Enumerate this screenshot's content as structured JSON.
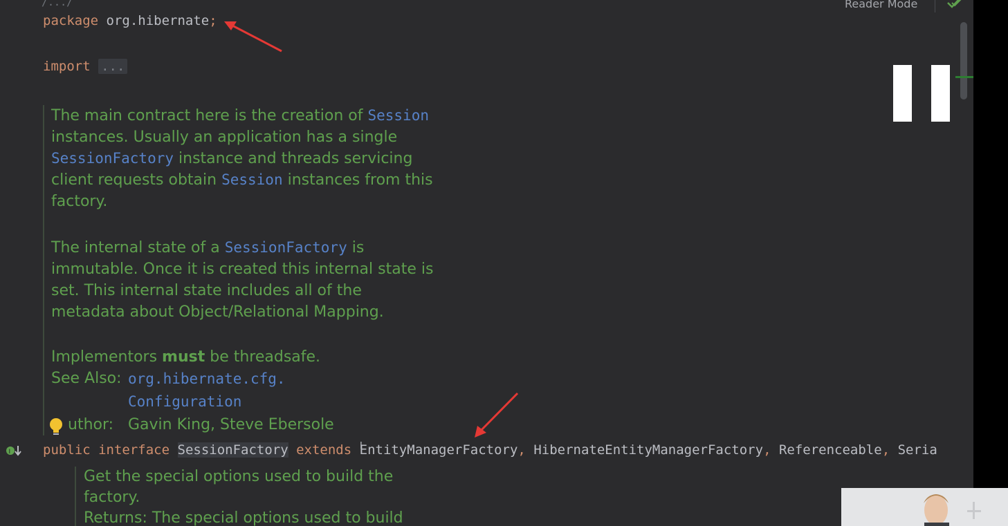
{
  "code": {
    "fold_marker": "/.../",
    "package_kw": "package",
    "package_name": "org.hibernate",
    "semicolon": ";",
    "import_kw": "import",
    "import_dots": "..."
  },
  "javadoc": {
    "p1": [
      "The main contract here is the creation of ",
      "Session",
      " instances. Usually an application has a single ",
      "SessionFactory",
      " instance and threads servicing client requests obtain ",
      "Session",
      " instances from this factory."
    ],
    "p2": [
      "The internal state of a ",
      "SessionFactory",
      " is immutable. Once it is created this internal state is set. This internal state includes all of the metadata about Object/Relational Mapping."
    ],
    "p3_pre": "Implementors ",
    "p3_bold": "must",
    "p3_post": " be threadsafe.",
    "see_also_label": "See Also:",
    "see_also_link1": "org.hibernate.cfg.",
    "see_also_link2": "Configuration",
    "author_label": "uthor:",
    "author_value": "Gavin King, Steve Ebersole"
  },
  "declaration": {
    "public_kw": "public",
    "interface_kw": "interface",
    "name": "SessionFactory",
    "extends_kw": "extends",
    "types": [
      "EntityManagerFactory",
      "HibernateEntityManagerFactory",
      "Referenceable",
      "Seria"
    ],
    "comma": ","
  },
  "method_doc": {
    "line1": "Get the special options used to build the",
    "line2": "factory.",
    "line3": "Returns: The special options used to build"
  },
  "toolbar": {
    "reader_mode": "Reader Mode"
  },
  "colors": {
    "background": "#2b2b2d",
    "keyword": "#cf8e6d",
    "doc_text": "#5fa04e",
    "doc_link": "#5782c8",
    "annotation_arrow": "#e53935"
  },
  "icons": [
    "lightbulb-icon",
    "implementations-gutter-icon",
    "checkmark-icon",
    "pause-icon",
    "arrow-annotation"
  ]
}
